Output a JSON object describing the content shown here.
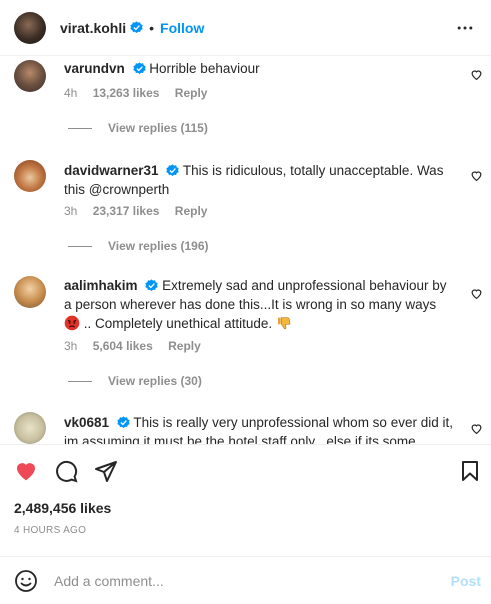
{
  "header": {
    "username": "virat.kohli",
    "separator": "•",
    "follow_label": "Follow",
    "verified_icon": "verified-badge-icon",
    "more_icon": "more-options-icon"
  },
  "comments": [
    {
      "username": "varundvn",
      "text": "Horrible behaviour",
      "time": "4h",
      "likes": "13,263 likes",
      "reply_label": "Reply",
      "view_replies": "View replies (115)"
    },
    {
      "username": "davidwarner31",
      "text": "This is ridiculous, totally unacceptable. Was this @crownperth",
      "time": "3h",
      "likes": "23,317 likes",
      "reply_label": "Reply",
      "view_replies": "View replies (196)"
    },
    {
      "username": "aalimhakim",
      "text": "Extremely sad and unprofessional behaviour by a person wherever has done this...It is wrong in so many ways",
      "text_tail": ".. Completely unethical attitude.",
      "emojis": [
        "angry-face-icon",
        "thumbs-down-icon"
      ],
      "time": "3h",
      "likes": "5,604 likes",
      "reply_label": "Reply",
      "view_replies": "View replies (30)"
    },
    {
      "username": "vk0681",
      "text": "This is really very unprofessional whom so ever did it, im assuming it must be the hotel staff only , else if its some"
    }
  ],
  "actions": {
    "like_icon": "heart-filled-icon",
    "comment_icon": "comment-icon",
    "share_icon": "share-icon",
    "save_icon": "bookmark-icon",
    "like_color": "#ed4956"
  },
  "post": {
    "likes": "2,489,456 likes",
    "timestamp": "4 HOURS AGO"
  },
  "add_comment": {
    "placeholder": "Add a comment...",
    "post_label": "Post",
    "emoji_icon": "emoji-icon"
  },
  "colors": {
    "accent": "#0095f6",
    "post_disabled": "#b2dffc",
    "muted": "#8e8e8e",
    "text": "#262626"
  }
}
